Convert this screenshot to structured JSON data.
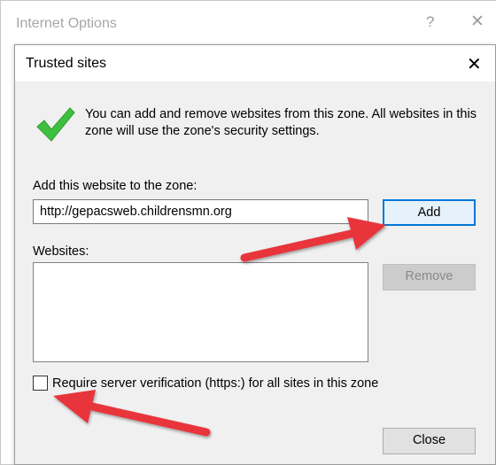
{
  "parent_window": {
    "title": "Internet Options",
    "help_glyph": "?",
    "close_glyph": "✕"
  },
  "dialog": {
    "title": "Trusted sites",
    "close_glyph": "✕",
    "intro_text": "You can add and remove websites from this zone. All websites in this zone will use the zone's security settings.",
    "add_label": "Add this website to the zone:",
    "url_value": "http://gepacsweb.childrensmn.org",
    "add_button": "Add",
    "websites_label": "Websites:",
    "websites": [],
    "remove_button": "Remove",
    "require_label": "Require server verification (https:) for all sites in this zone",
    "require_checked": false,
    "close_button": "Close"
  },
  "colors": {
    "accent_focus": "#0078d7",
    "check_green": "#3fbf3f",
    "annotation_red": "#e8353b"
  },
  "icons": {
    "checkmark": "checkmark-icon",
    "arrow": "red-arrow-icon"
  }
}
